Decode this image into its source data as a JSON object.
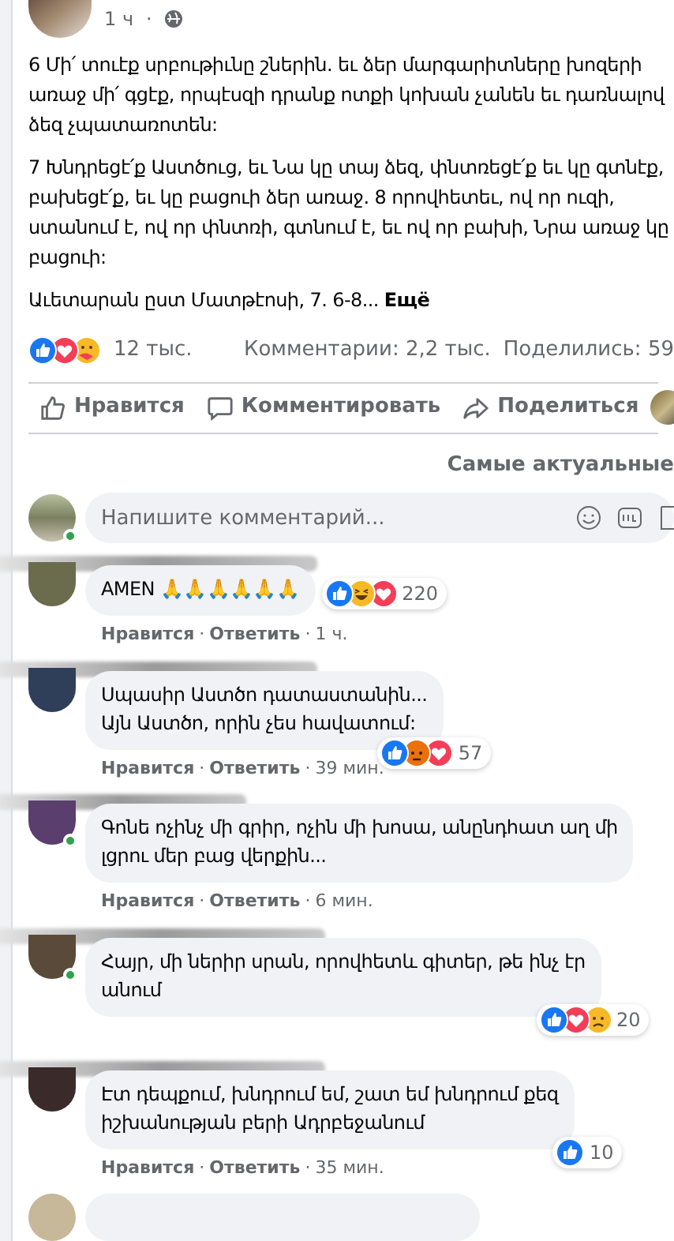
{
  "separator": "·",
  "post": {
    "time": "1 ч",
    "paragraphs": [
      {
        "lines": [
          "6 Մի՛ տուէք սրբութիւնը շներին. եւ ձեր մարգարիտները խոզերի",
          "առաջ մի՛ գցէք, որպէսզի դրանք ոտքի կոխան չանեն եւ դառնալով",
          "ձեզ չպատառոտեն:"
        ]
      },
      {
        "lines": [
          "7 Խնդրեցէ՛ք Աստծուց, եւ Նա կը տայ ձեզ, փնտռեցէ՛ք եւ կը գտնէք,",
          "բախեցէ՛ք, եւ կը բացուի ձեր առաջ. 8 որովհետեւ, ով որ ուզի,",
          "ստանում է, ով որ փնտռի, գտնում է, եւ ով որ բախի, Նրա առաջ կը",
          "բացուի:"
        ]
      },
      {
        "lines": [
          "Աւետարան ըստ Մատթէոսի, 7. 6-8..."
        ],
        "more": "Ещё"
      }
    ],
    "reactions": [
      {
        "kind": "like"
      },
      {
        "kind": "love"
      },
      {
        "kind": "care"
      }
    ],
    "reaction_count": "12 тыс.",
    "comments_count": "Комментарии: 2,2 тыс.",
    "shares": "Поделились: 59"
  },
  "actions": [
    "Нравится",
    "Комментировать",
    "Поделиться"
  ],
  "sort": "Самые актуальные",
  "comment_box": {
    "placeholder": "Напишите комментарий...",
    "online": true
  },
  "comments": [
    {
      "color": "#6b6b4e",
      "online": false,
      "lines": [
        "AMEN 🙏🙏🙏🙏🙏🙏"
      ],
      "reactions": [
        {
          "kind": "like"
        },
        {
          "kind": "haha"
        },
        {
          "kind": "love"
        }
      ],
      "count": "220",
      "inline_reactions": true,
      "like": "Нравится",
      "reply": "Ответить",
      "time": "1 ч."
    },
    {
      "color": "#2f3f5a",
      "online": false,
      "lines": [
        "Սպասիր Աստծո դատաստանին...",
        "Այն Աստծո, որին չես հավատում:"
      ],
      "reactions": [
        {
          "kind": "like"
        },
        {
          "kind": "angry"
        },
        {
          "kind": "love"
        }
      ],
      "count": "57",
      "like": "Нравится",
      "reply": "Ответить",
      "time": "39 мин."
    },
    {
      "color": "#5a3f6e",
      "online": true,
      "lines": [
        "Գոնե ոչինչ մի գրիր, ոչին մի խոսա, անընդհատ աղ մի",
        "լցրու մեր բաց վերքին..."
      ],
      "like": "Нравится",
      "reply": "Ответить",
      "time": "6 мин."
    },
    {
      "color": "#5a4a3a",
      "online": true,
      "lines": [
        "Հայր, մի ներիր սրան, որովհետև գիտեր, թե ինչ էր",
        "անում"
      ],
      "reactions": [
        {
          "kind": "like"
        },
        {
          "kind": "love"
        },
        {
          "kind": "sad"
        }
      ],
      "count": "20"
    },
    {
      "color": "#3a2a2a",
      "online": false,
      "lines": [
        "Էտ դեպքում, խնդրում եմ, շատ եմ խնդրում քեզ",
        "իշխանության բերի Ադրբեջանում"
      ],
      "reactions": [
        {
          "kind": "like"
        }
      ],
      "count": "10",
      "like": "Нравится",
      "reply": "Ответить",
      "time": "35 мин."
    }
  ]
}
